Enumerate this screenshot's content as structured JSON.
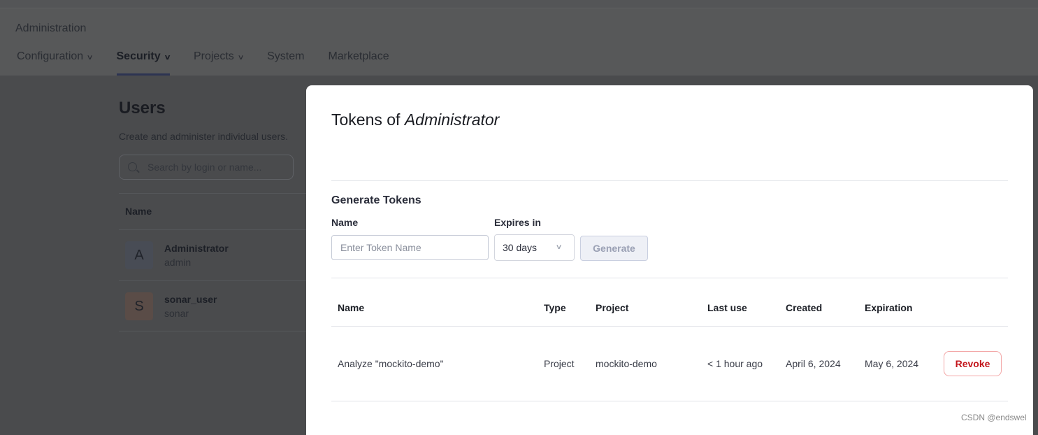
{
  "header": {
    "title": "Administration",
    "nav": [
      {
        "label": "Configuration",
        "dropdown": true
      },
      {
        "label": "Security",
        "dropdown": true,
        "active": true
      },
      {
        "label": "Projects",
        "dropdown": true
      },
      {
        "label": "System"
      },
      {
        "label": "Marketplace"
      }
    ]
  },
  "users": {
    "title": "Users",
    "description": "Create and administer individual users.",
    "search_placeholder": "Search by login or name...",
    "column_name": "Name",
    "rows": [
      {
        "initial": "A",
        "name": "Administrator",
        "login": "admin"
      },
      {
        "initial": "S",
        "name": "sonar_user",
        "login": "sonar"
      }
    ]
  },
  "modal": {
    "title_prefix": "Tokens of",
    "title_user": "Administrator",
    "generate_title": "Generate Tokens",
    "name_label": "Name",
    "name_placeholder": "Enter Token Name",
    "expires_label": "Expires in",
    "expires_value": "30 days",
    "generate_button": "Generate",
    "columns": [
      "Name",
      "Type",
      "Project",
      "Last use",
      "Created",
      "Expiration"
    ],
    "tokens": [
      {
        "name": "Analyze \"mockito-demo\"",
        "type": "Project",
        "project": "mockito-demo",
        "last_use": "< 1 hour ago",
        "created": "April 6, 2024",
        "expiration": "May 6, 2024",
        "action": "Revoke"
      }
    ]
  },
  "watermark": "CSDN @endswel",
  "colors": {
    "danger": "#c3161c",
    "active_underline": "#2d3452"
  }
}
